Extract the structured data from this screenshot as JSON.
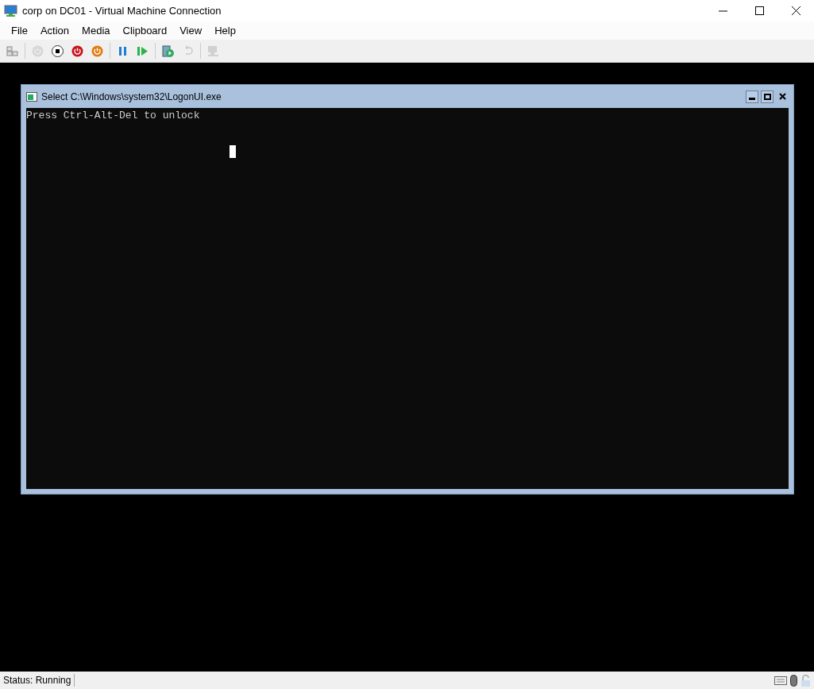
{
  "window": {
    "title": "corp on DC01 - Virtual Machine Connection"
  },
  "menu": [
    "File",
    "Action",
    "Media",
    "Clipboard",
    "View",
    "Help"
  ],
  "toolbar": [
    {
      "kind": "ctrl-alt-del",
      "disabled": false
    },
    {
      "kind": "start",
      "disabled": true
    },
    {
      "kind": "turn-off",
      "disabled": false
    },
    {
      "kind": "shut-down",
      "disabled": false
    },
    {
      "kind": "save",
      "disabled": false
    },
    {
      "kind": "pause",
      "disabled": false
    },
    {
      "kind": "reset",
      "disabled": false
    },
    {
      "kind": "checkpoint",
      "disabled": false
    },
    {
      "kind": "revert",
      "disabled": true
    },
    {
      "kind": "enhanced-session",
      "disabled": true
    }
  ],
  "console": {
    "title": "Select C:\\Windows\\system32\\LogonUI.exe",
    "lines": [
      "Press Ctrl-Alt-Del to unlock"
    ]
  },
  "status_bar": {
    "status": "Status: Running"
  }
}
